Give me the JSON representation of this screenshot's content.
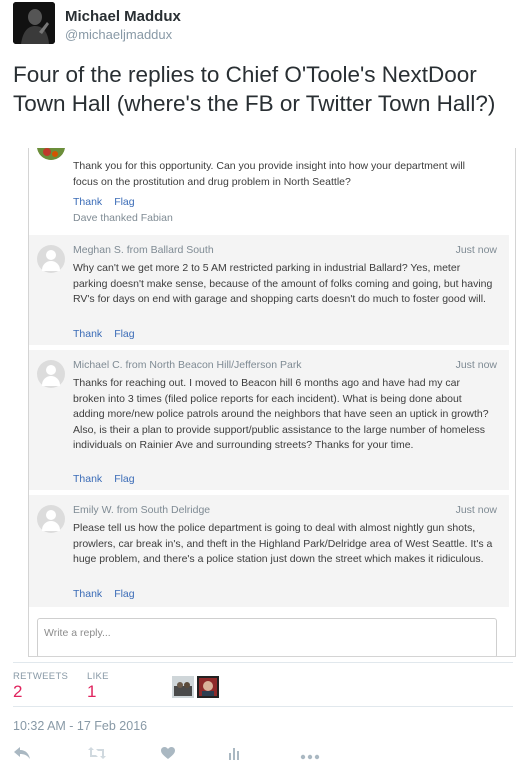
{
  "tweet": {
    "author_name": "Michael Maddux",
    "author_handle": "@michaeljmaddux",
    "text": "Four of the replies to Chief O'Toole's NextDoor Town Hall (where's the FB or Twitter Town Hall?)",
    "timestamp": "10:32 AM - 17 Feb 2016"
  },
  "replies": [
    {
      "author": "",
      "time": "",
      "text": "Thank you for this opportunity. Can you provide insight into how your department will focus on the prostitution and drug problem in North Seattle?",
      "thank_label": "Thank",
      "flag_label": "Flag",
      "thanked_note": "Dave thanked Fabian"
    },
    {
      "author": "Meghan S. from Ballard South",
      "time": "Just now",
      "text": "Why can't we get more 2 to 5 AM restricted parking in industrial Ballard? Yes, meter parking doesn't make sense, because of the amount of folks coming and going, but having RV's for days on end with garage and shopping carts doesn't do much to foster good will.",
      "thank_label": "Thank",
      "flag_label": "Flag"
    },
    {
      "author": "Michael C. from North Beacon Hill/Jefferson Park",
      "time": "Just now",
      "text": "Thanks for reaching out. I moved to Beacon hill 6 months ago and have had my car broken into 3 times (filed police reports for each incident). What is being done about adding more/new police patrols around the neighbors that have seen an uptick in growth? Also, is their a plan to provide support/public assistance to the large number of homeless individuals on Rainier Ave and surrounding streets? Thanks for your time.",
      "thank_label": "Thank",
      "flag_label": "Flag"
    },
    {
      "author": "Emily W. from South Delridge",
      "time": "Just now",
      "text": "Please tell us how the police department is going to deal with almost nightly gun shots, prowlers, car break in's, and theft in the Highland Park/Delridge area of West Seattle. It's a huge problem, and there's a police station just down the street which makes it ridiculous.",
      "thank_label": "Thank",
      "flag_label": "Flag"
    }
  ],
  "reply_box": {
    "placeholder": "Write a reply..."
  },
  "stats": {
    "retweets_label": "RETWEETS",
    "retweets_value": "2",
    "likes_label": "LIKE",
    "likes_value": "1"
  },
  "actions": [
    "reply-icon",
    "retweet-icon",
    "like-icon",
    "analytics-icon",
    "more-icon"
  ],
  "colors": {
    "accent": "#e0245e",
    "link": "#3b6cb7",
    "muted": "#8899a6"
  }
}
